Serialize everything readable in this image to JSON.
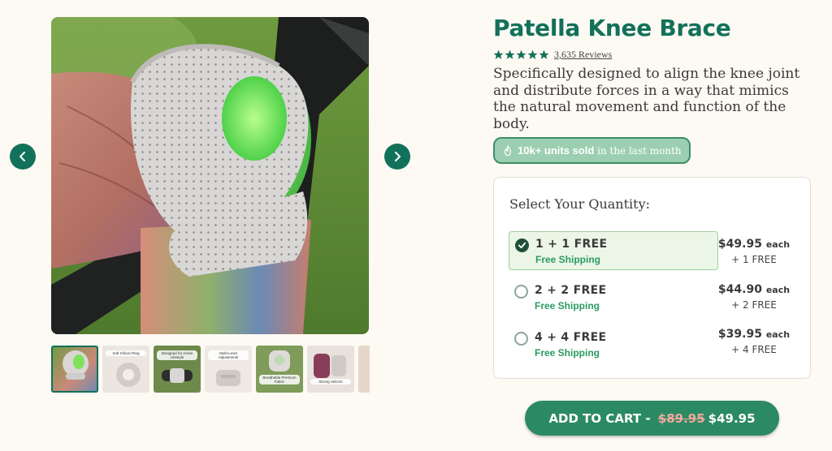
{
  "product": {
    "title": "Patella Knee Brace",
    "rating": 5,
    "reviews_text": "3,635 Reviews",
    "description": "Specifically designed to align the knee joint and distribute forces in a way that mimics the natural movement and function of the body.",
    "sold_badge": {
      "bold": "10k+ units sold",
      "rest": " in the last month"
    }
  },
  "gallery": {
    "main_image_alt": "knee brace on leg",
    "thumbnails": [
      {
        "label": ""
      },
      {
        "label": "Soft Silicon Ring"
      },
      {
        "label": "Designed for Active Lifestyle"
      },
      {
        "label": "Multi-Level Adjustments"
      },
      {
        "label": "Breathable Premium Fabric"
      },
      {
        "label": "Strong Velcros"
      },
      {
        "label": ""
      }
    ]
  },
  "quantity": {
    "heading": "Select Your Quantity:",
    "options": [
      {
        "name": "1 + 1 FREE",
        "shipping": "Free Shipping",
        "price": "$49.95",
        "each": "each",
        "free": "+ 1 FREE",
        "selected": true
      },
      {
        "name": "2 + 2 FREE",
        "shipping": "Free Shipping",
        "price": "$44.90",
        "each": "each",
        "free": "+ 2 FREE",
        "selected": false
      },
      {
        "name": "4 + 4 FREE",
        "shipping": "Free Shipping",
        "price": "$39.95",
        "each": "each",
        "free": "+ 4 FREE",
        "selected": false
      }
    ]
  },
  "cart": {
    "label": "ADD TO CART - ",
    "old_price": "$89.95",
    "price": "$49.95"
  },
  "colors": {
    "brand": "#12715a",
    "button": "#2b8a63",
    "background": "#fdf9f3"
  }
}
